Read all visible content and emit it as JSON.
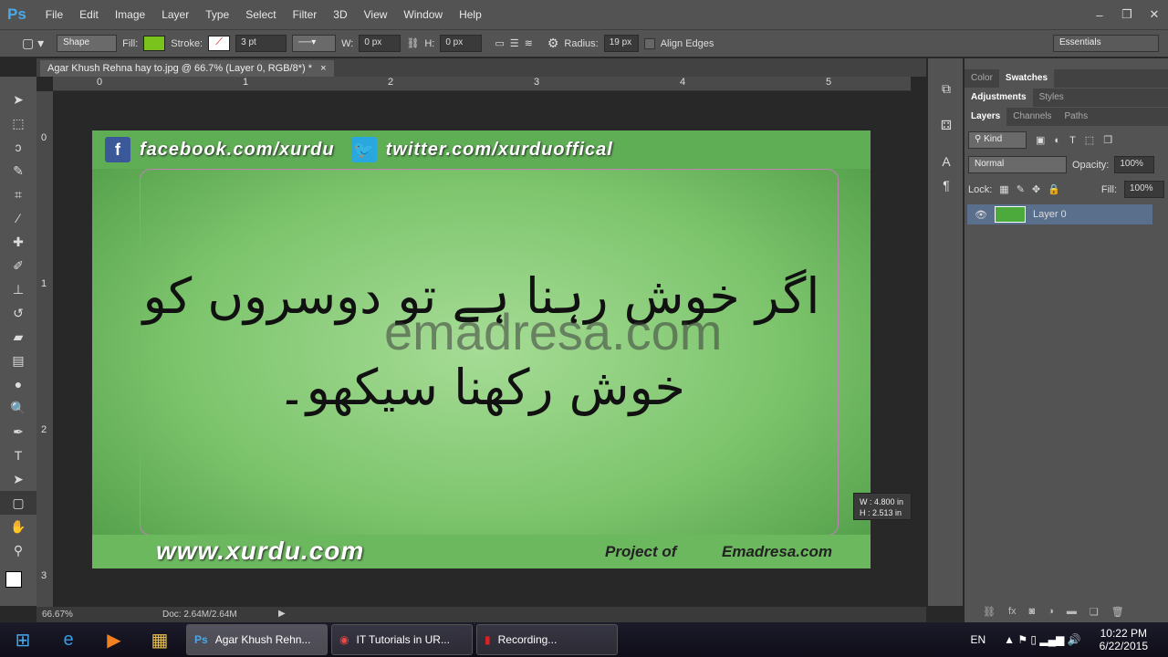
{
  "app": {
    "logo": "Ps",
    "menu": [
      "File",
      "Edit",
      "Image",
      "Layer",
      "Type",
      "Select",
      "Filter",
      "3D",
      "View",
      "Window",
      "Help"
    ]
  },
  "options": {
    "mode": "Shape",
    "fill_label": "Fill:",
    "fill_color": "#7ac21c",
    "stroke_label": "Stroke:",
    "stroke_width": "3 pt",
    "w_label": "W:",
    "w_value": "0 px",
    "h_label": "H:",
    "h_value": "0 px",
    "radius_label": "Radius:",
    "radius_value": "19 px",
    "align_edges": "Align Edges",
    "workspace": "Essentials"
  },
  "document": {
    "tab_title": "Agar Khush Rehna hay to.jpg @ 66.7% (Layer 0, RGB/8*) *",
    "ruler_h": [
      "0",
      "1",
      "2",
      "3",
      "4",
      "5"
    ],
    "ruler_v": [
      "0",
      "1",
      "2",
      "3"
    ]
  },
  "image": {
    "facebook": "facebook.com/xurdu",
    "twitter": "twitter.com/xurduoffical",
    "line1": "اگر خوش رہنا ہے تو دوسروں کو",
    "line2": "خوش رکھنا سیکھو۔",
    "watermark": "emadresa.com",
    "website": "www.xurdu.com",
    "project_of": "Project of",
    "emadresa": "Emadresa.com"
  },
  "tooltip": {
    "w": "W :  4.800 in",
    "h": "H :  2.513 in"
  },
  "status": {
    "zoom": "66.67%",
    "doc": "Doc: 2.64M/2.64M"
  },
  "panels": {
    "tabs1": [
      "Color",
      "Swatches"
    ],
    "tabs2": [
      "Adjustments",
      "Styles"
    ],
    "tabs3": [
      "Layers",
      "Channels",
      "Paths"
    ],
    "kind": "Kind",
    "blend": "Normal",
    "opacity_label": "Opacity:",
    "opacity": "100%",
    "lock_label": "Lock:",
    "fill_label": "Fill:",
    "fill": "100%",
    "layers": [
      {
        "name": "Layer 0"
      }
    ]
  },
  "taskbar": {
    "tasks": [
      "Agar Khush Rehn...",
      "IT Tutorials in UR...",
      "Recording..."
    ],
    "lang": "EN",
    "time": "10:22 PM",
    "date": "6/22/2015"
  }
}
